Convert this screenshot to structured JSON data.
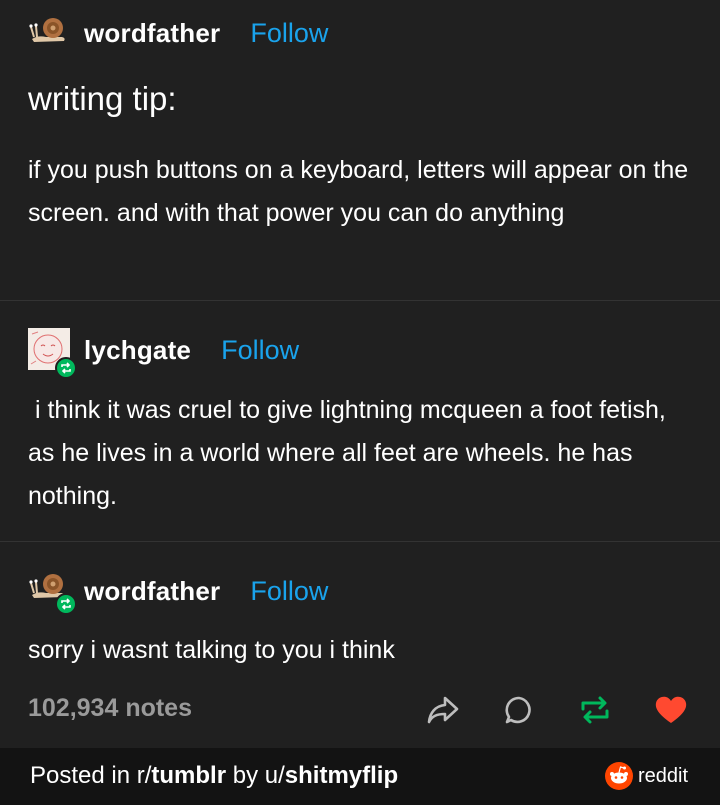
{
  "posts": [
    {
      "username": "wordfather",
      "follow_label": "Follow",
      "title": "writing tip:",
      "body": "if you push buttons on a keyboard, letters will appear on the screen. and with that power you can do anything"
    },
    {
      "username": "lychgate",
      "follow_label": "Follow",
      "body": " i think it was cruel to give lightning mcqueen a foot fetish, as he lives in a world where all feet are wheels. he has nothing."
    },
    {
      "username": "wordfather",
      "follow_label": "Follow",
      "body": "sorry i wasnt talking to you i think"
    }
  ],
  "footer": {
    "notes": "102,934 notes",
    "icons": [
      "share-icon",
      "reply-icon",
      "reblog-icon",
      "like-icon"
    ]
  },
  "reddit_bar": {
    "posted_in_prefix": "Posted in r/",
    "subreddit": "tumblr",
    "by_prefix": " by u/",
    "user": "shitmyflip",
    "brand": "reddit"
  },
  "colors": {
    "background": "#202020",
    "follow": "#1aa3ec",
    "reblog_green": "#00b85c",
    "like_red": "#ff4930",
    "notes_gray": "#9a9a9a",
    "reddit_orange": "#ff4500"
  }
}
